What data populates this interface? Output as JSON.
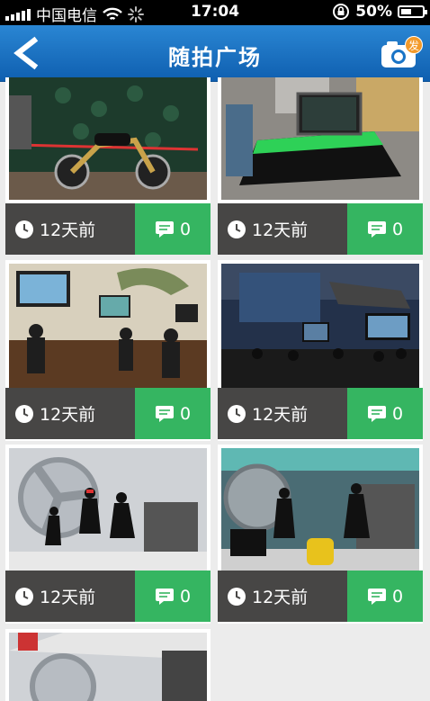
{
  "status_bar": {
    "carrier": "中国电信",
    "time": "17:04",
    "battery": "50%",
    "battery_level": 0.5
  },
  "nav": {
    "title": "随拍广场",
    "camera_badge": "发"
  },
  "posts": [
    {
      "time": "12天前",
      "comments": "0",
      "photo": "motorcycle-booth"
    },
    {
      "time": "12天前",
      "comments": "0",
      "photo": "laptop-display"
    },
    {
      "time": "12天前",
      "comments": "0",
      "photo": "gaming-area"
    },
    {
      "time": "12天前",
      "comments": "0",
      "photo": "gaming-stage"
    },
    {
      "time": "12天前",
      "comments": "0",
      "photo": "dancers-stage"
    },
    {
      "time": "12天前",
      "comments": "0",
      "photo": "dancers-stage"
    }
  ]
}
